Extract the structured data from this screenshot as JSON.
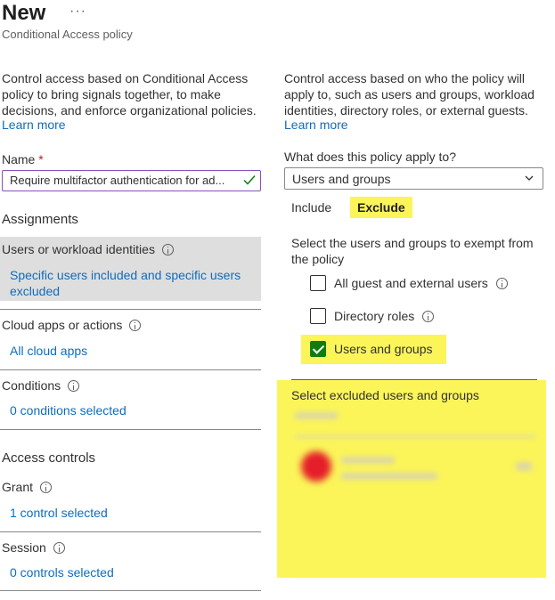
{
  "header": {
    "title": "New",
    "more": "···",
    "subtitle": "Conditional Access policy"
  },
  "left": {
    "description": "Control access based on Conditional Access policy to bring signals together, to make decisions, and enforce organizational policies.",
    "learn_more": "Learn more",
    "name_label": "Name",
    "required_mark": "*",
    "name_value": "Require multifactor authentication for ad...",
    "assignments_heading": "Assignments",
    "users_title": "Users or workload identities",
    "users_value": "Specific users included and specific users excluded",
    "cloud_title": "Cloud apps or actions",
    "cloud_value": "All cloud apps",
    "conditions_title": "Conditions",
    "conditions_value": "0 conditions selected",
    "access_heading": "Access controls",
    "grant_title": "Grant",
    "grant_value": "1 control selected",
    "session_title": "Session",
    "session_value": "0 controls selected"
  },
  "right": {
    "description": "Control access based on who the policy will apply to, such as users and groups, workload identities, directory roles, or external guests.",
    "learn_more": "Learn more",
    "apply_label": "What does this policy apply to?",
    "apply_value": "Users and groups",
    "tabs": [
      {
        "label": "Include",
        "active": false
      },
      {
        "label": "Exclude",
        "active": true
      }
    ],
    "exempt_text": "Select the users and groups to exempt from the policy",
    "options": [
      {
        "label": "All guest and external users",
        "checked": false
      },
      {
        "label": "Directory roles",
        "checked": false
      },
      {
        "label": "Users and groups",
        "checked": true
      }
    ],
    "excluded_heading": "Select excluded users and groups"
  },
  "colors": {
    "link": "#0f6cbd",
    "highlight": "#fbf55a",
    "checked": "#107c10",
    "input_border": "#8a4fb8",
    "selected_row": "#dedede"
  }
}
